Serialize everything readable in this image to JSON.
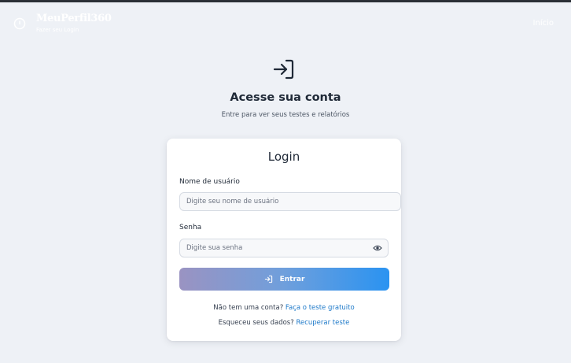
{
  "header": {
    "brand_name": "MeuPerfil360",
    "brand_subtitle": "Fazer seu Login",
    "nav_home": "Início"
  },
  "hero": {
    "icon": "login-arrow-icon",
    "title": "Acesse sua conta",
    "subtitle": "Entre para ver seus testes e relatórios"
  },
  "login_card": {
    "title": "Login",
    "username": {
      "label": "Nome de usuário",
      "placeholder": "Digite seu nome de usuário",
      "value": ""
    },
    "password": {
      "label": "Senha",
      "placeholder": "Digite sua senha",
      "value": "",
      "toggle_icon": "eye-icon"
    },
    "submit": {
      "label": "Entrar",
      "icon": "login-arrow-icon"
    },
    "signup": {
      "prompt": "Não tem uma conta?",
      "link": "Faça o teste gratuito"
    },
    "recover": {
      "prompt": "Esqueceu seus dados?",
      "link": "Recuperar teste"
    }
  },
  "colors": {
    "background": "#eef1f6",
    "link": "#1d79c9",
    "button_gradient_start": "#9a93c2",
    "button_gradient_end": "#2a93f1"
  }
}
